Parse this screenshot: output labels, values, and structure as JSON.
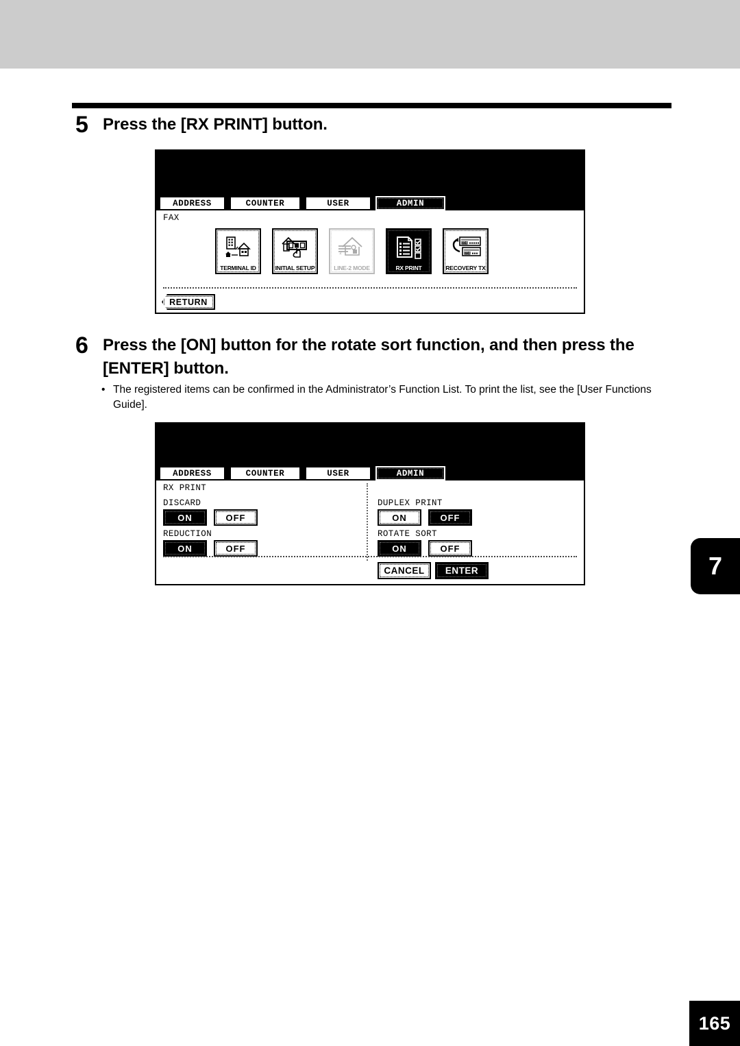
{
  "page": {
    "chapter_tab": "7",
    "page_number": "165"
  },
  "steps": [
    {
      "number": "5",
      "title": "Press the [RX PRINT] button."
    },
    {
      "number": "6",
      "title": "Press the [ON] button for the rotate sort function, and then press the [ENTER] button.",
      "bullets": [
        "The registered items can be confirmed in the Administrator’s Function List. To print the list, see the [User Functions Guide]."
      ]
    }
  ],
  "panel1": {
    "tabs": [
      {
        "label": "ADDRESS",
        "active": false
      },
      {
        "label": "COUNTER",
        "active": false
      },
      {
        "label": "USER",
        "active": false
      },
      {
        "label": "ADMIN",
        "active": true
      }
    ],
    "screen_title": "FAX",
    "icons": [
      {
        "caption": "TERMINAL ID",
        "icon": "building-house-icon",
        "state": "normal"
      },
      {
        "caption": "INITIAL SETUP",
        "icon": "house-panel-hand-icon",
        "state": "normal"
      },
      {
        "caption": "LINE-2 MODE",
        "icon": "house-line2-icon",
        "state": "disabled"
      },
      {
        "caption": "RX PRINT",
        "icon": "document-checklist-icon",
        "state": "selected"
      },
      {
        "caption": "RECOVERY TX",
        "icon": "recovery-transmit-icon",
        "state": "normal"
      }
    ],
    "return_label": "RETURN"
  },
  "panel2": {
    "tabs": [
      {
        "label": "ADDRESS",
        "active": false
      },
      {
        "label": "COUNTER",
        "active": false
      },
      {
        "label": "USER",
        "active": false
      },
      {
        "label": "ADMIN",
        "active": true
      }
    ],
    "screen_title": "RX PRINT",
    "settings": [
      {
        "label": "DISCARD",
        "on": "ON",
        "off": "OFF",
        "selected": "ON"
      },
      {
        "label": "REDUCTION",
        "on": "ON",
        "off": "OFF",
        "selected": "ON"
      },
      {
        "label": "DUPLEX PRINT",
        "on": "ON",
        "off": "OFF",
        "selected": "OFF"
      },
      {
        "label": "ROTATE SORT",
        "on": "ON",
        "off": "OFF",
        "selected": "ON"
      }
    ],
    "cancel_label": "CANCEL",
    "enter_label": "ENTER"
  },
  "colors": {
    "ink": "#000000",
    "band": "#cccccc",
    "paper": "#ffffff"
  }
}
